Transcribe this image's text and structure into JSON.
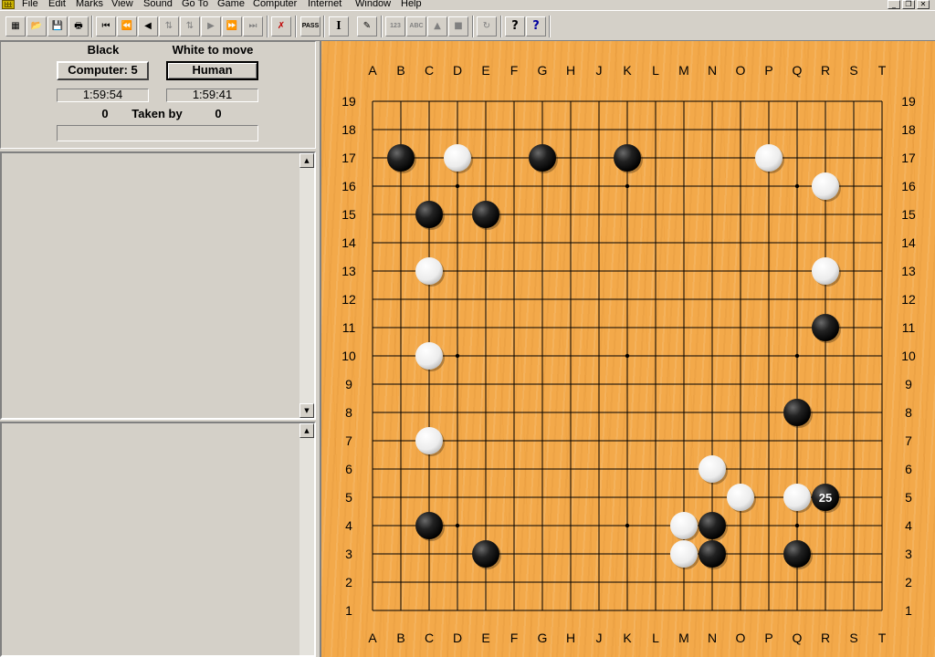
{
  "menu": [
    "File",
    "Edit",
    "Marks",
    "View",
    "Sound",
    "Go To",
    "Game",
    "Computer",
    "Internet",
    "Window",
    "Help"
  ],
  "window_buttons": [
    "minimize",
    "restore",
    "close"
  ],
  "toolbar": [
    {
      "name": "new-board-button",
      "glyph": "▦"
    },
    {
      "name": "open-file-button",
      "glyph": "📂"
    },
    {
      "name": "save-file-button",
      "glyph": "💾"
    },
    {
      "name": "print-button",
      "glyph": "🖶"
    },
    {
      "name": "go-to-start-button",
      "glyph": "⏮"
    },
    {
      "name": "back-ten-moves-button",
      "glyph": "⏪"
    },
    {
      "name": "back-one-move-button",
      "glyph": "◀"
    },
    {
      "name": "previous-variation-button",
      "glyph": "⇅"
    },
    {
      "name": "next-variation-button",
      "glyph": "⇅"
    },
    {
      "name": "forward-one-move-button",
      "glyph": "▶"
    },
    {
      "name": "forward-ten-moves-button",
      "glyph": "⏩"
    },
    {
      "name": "go-to-end-button",
      "glyph": "⏭"
    },
    {
      "name": "undo-move-button",
      "glyph": "✗"
    },
    {
      "name": "pass-button",
      "glyph": "PASS"
    },
    {
      "name": "text-mode-button",
      "glyph": "I"
    },
    {
      "name": "comment-button",
      "glyph": "✎"
    },
    {
      "name": "numbers-button",
      "glyph": "123"
    },
    {
      "name": "letters-button",
      "glyph": "ABC"
    },
    {
      "name": "triangle-mark-button",
      "glyph": "▲"
    },
    {
      "name": "square-mark-button",
      "glyph": "■"
    },
    {
      "name": "redo-button",
      "glyph": "↻"
    },
    {
      "name": "help-button",
      "glyph": "?"
    },
    {
      "name": "context-help-button",
      "glyph": "?"
    }
  ],
  "game_info": {
    "black_label": "Black",
    "white_label": "White to move",
    "black_player": "Computer: 5",
    "white_player": "Human",
    "black_time": "1:59:54",
    "white_time": "1:59:41",
    "black_captures": "0",
    "taken_by_label": "Taken by",
    "white_captures": "0"
  },
  "board": {
    "size": 19,
    "columns": [
      "A",
      "B",
      "C",
      "D",
      "E",
      "F",
      "G",
      "H",
      "J",
      "K",
      "L",
      "M",
      "N",
      "O",
      "P",
      "Q",
      "R",
      "S",
      "T"
    ],
    "rows": [
      "19",
      "18",
      "17",
      "16",
      "15",
      "14",
      "13",
      "12",
      "11",
      "10",
      "9",
      "8",
      "7",
      "6",
      "5",
      "4",
      "3",
      "2",
      "1"
    ],
    "hoshi": [
      "D16",
      "K16",
      "Q16",
      "D10",
      "K10",
      "Q10",
      "D4",
      "K4",
      "Q4"
    ],
    "black_stones": [
      "B17",
      "G17",
      "K17",
      "C15",
      "E15",
      "R11",
      "Q8",
      "R5",
      "C4",
      "N4",
      "E3",
      "N3",
      "Q3"
    ],
    "white_stones": [
      "D17",
      "P17",
      "R16",
      "C13",
      "R13",
      "C10",
      "C7",
      "N6",
      "O5",
      "Q5",
      "M4",
      "M3"
    ],
    "last_move": {
      "point": "R5",
      "number": "25"
    },
    "colors": {
      "board": "#f3a94a",
      "line": "#000000",
      "black": "#1a1a1a",
      "white": "#f4f4f4"
    }
  }
}
